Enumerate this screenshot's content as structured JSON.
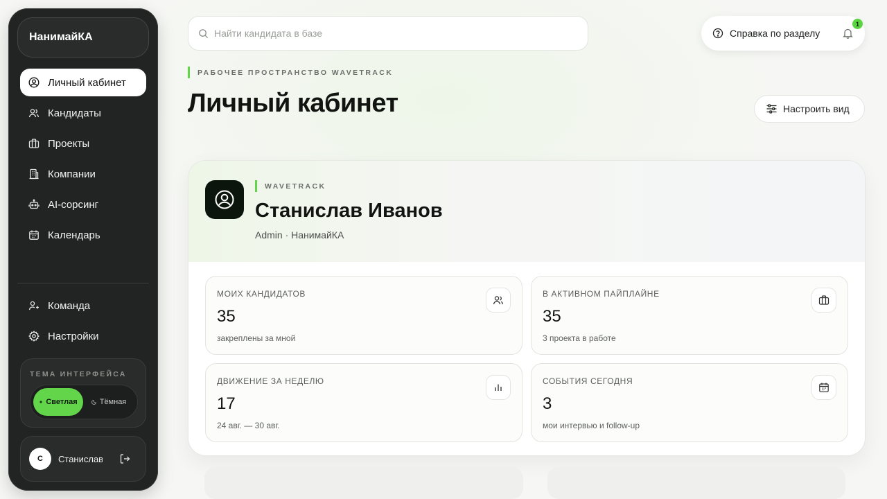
{
  "sidebar": {
    "brand": "НанимайКА",
    "items": [
      {
        "label": "Личный кабинет",
        "icon": "user-circle-icon",
        "active": true
      },
      {
        "label": "Кандидаты",
        "icon": "users-icon"
      },
      {
        "label": "Проекты",
        "icon": "briefcase-icon"
      },
      {
        "label": "Компании",
        "icon": "building-icon"
      },
      {
        "label": "AI-сорсинг",
        "icon": "robot-icon"
      },
      {
        "label": "Календарь",
        "icon": "calendar-icon"
      }
    ],
    "bottom_items": [
      {
        "label": "Команда",
        "icon": "team-icon"
      },
      {
        "label": "Настройки",
        "icon": "gear-icon"
      }
    ],
    "theme": {
      "title": "ТЕМА ИНТЕРФЕЙСА",
      "light": "Светлая",
      "dark": "Тёмная",
      "selected": "Светлая"
    },
    "user": {
      "initial": "С",
      "name": "Станислав Иванов"
    }
  },
  "header": {
    "search_placeholder": "Найти кандидата в базе",
    "help_label": "Справка по разделу",
    "notification_count": "1",
    "eyebrow": "РАБОЧЕЕ ПРОСТРАНСТВО WAVETRACK",
    "title": "Личный кабинет",
    "customize_label": "Настроить вид"
  },
  "profile": {
    "eyebrow": "WAVETRACK",
    "name": "Станислав Иванов",
    "role": "Admin · НанимайКА"
  },
  "stats": [
    {
      "label": "МОИХ КАНДИДАТОВ",
      "value": "35",
      "sub": "закреплены за мной",
      "icon": "users-icon"
    },
    {
      "label": "В АКТИВНОМ ПАЙПЛАЙНЕ",
      "value": "35",
      "sub": "3 проекта в работе",
      "icon": "briefcase-icon"
    },
    {
      "label": "ДВИЖЕНИЕ ЗА НЕДЕЛЮ",
      "value": "17",
      "sub": "24 авг. — 30 авг.",
      "icon": "bar-chart-icon"
    },
    {
      "label": "СОБЫТИЯ СЕГОДНЯ",
      "value": "3",
      "sub": "мои интервью и follow-up",
      "icon": "calendar-icon"
    }
  ],
  "colors": {
    "accent": "#62d54a",
    "sidebar_bg": "#222323",
    "card_icon_bg": "#0c150c"
  }
}
